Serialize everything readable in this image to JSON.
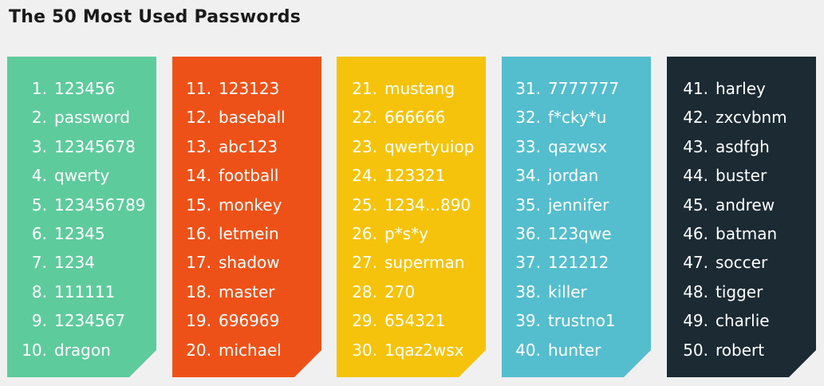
{
  "title": "The 50 Most Used Passwords",
  "columns": [
    {
      "color": "#5ecb9c",
      "items": [
        {
          "num": "1.",
          "pw": "123456"
        },
        {
          "num": "2.",
          "pw": "password"
        },
        {
          "num": "3.",
          "pw": "12345678"
        },
        {
          "num": "4.",
          "pw": "qwerty"
        },
        {
          "num": "5.",
          "pw": "123456789"
        },
        {
          "num": "6.",
          "pw": "12345"
        },
        {
          "num": "7.",
          "pw": "1234"
        },
        {
          "num": "8.",
          "pw": "111111"
        },
        {
          "num": "9.",
          "pw": "1234567"
        },
        {
          "num": "10.",
          "pw": "dragon"
        }
      ]
    },
    {
      "color": "#ee5118",
      "items": [
        {
          "num": "11.",
          "pw": "123123"
        },
        {
          "num": "12.",
          "pw": "baseball"
        },
        {
          "num": "13.",
          "pw": "abc123"
        },
        {
          "num": "14.",
          "pw": "football"
        },
        {
          "num": "15.",
          "pw": "monkey"
        },
        {
          "num": "16.",
          "pw": "letmein"
        },
        {
          "num": "17.",
          "pw": "shadow"
        },
        {
          "num": "18.",
          "pw": "master"
        },
        {
          "num": "19.",
          "pw": "696969"
        },
        {
          "num": "20.",
          "pw": "michael"
        }
      ]
    },
    {
      "color": "#f5c30b",
      "items": [
        {
          "num": "21.",
          "pw": "mustang"
        },
        {
          "num": "22.",
          "pw": "666666"
        },
        {
          "num": "23.",
          "pw": "qwertyuiop"
        },
        {
          "num": "24.",
          "pw": "123321"
        },
        {
          "num": "25.",
          "pw": "1234...890"
        },
        {
          "num": "26.",
          "pw": "p*s*y"
        },
        {
          "num": "27.",
          "pw": "superman"
        },
        {
          "num": "28.",
          "pw": "270"
        },
        {
          "num": "29.",
          "pw": "654321"
        },
        {
          "num": "30.",
          "pw": "1qaz2wsx"
        }
      ]
    },
    {
      "color": "#54bece",
      "items": [
        {
          "num": "31.",
          "pw": "7777777"
        },
        {
          "num": "32.",
          "pw": "f*cky*u"
        },
        {
          "num": "33.",
          "pw": "qazwsx"
        },
        {
          "num": "34.",
          "pw": "jordan"
        },
        {
          "num": "35.",
          "pw": "jennifer"
        },
        {
          "num": "36.",
          "pw": "123qwe"
        },
        {
          "num": "37.",
          "pw": "121212"
        },
        {
          "num": "38.",
          "pw": "killer"
        },
        {
          "num": "39.",
          "pw": "trustno1"
        },
        {
          "num": "40.",
          "pw": "hunter"
        }
      ]
    },
    {
      "color": "#1b2a33",
      "items": [
        {
          "num": "41.",
          "pw": "harley"
        },
        {
          "num": "42.",
          "pw": "zxcvbnm"
        },
        {
          "num": "43.",
          "pw": "asdfgh"
        },
        {
          "num": "44.",
          "pw": "buster"
        },
        {
          "num": "45.",
          "pw": "andrew"
        },
        {
          "num": "46.",
          "pw": "batman"
        },
        {
          "num": "47.",
          "pw": "soccer"
        },
        {
          "num": "48.",
          "pw": "tigger"
        },
        {
          "num": "49.",
          "pw": "charlie"
        },
        {
          "num": "50.",
          "pw": "robert"
        }
      ]
    }
  ]
}
